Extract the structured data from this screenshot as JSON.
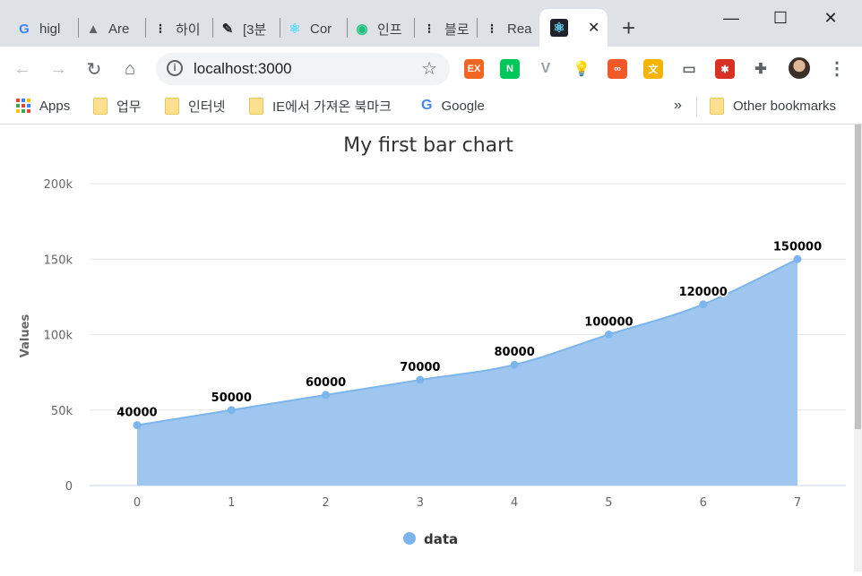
{
  "browser": {
    "tabs": [
      {
        "title": "higl",
        "icon": "google-icon",
        "fav": "G",
        "color": "#4285f4"
      },
      {
        "title": "Are",
        "icon": "arrow-logo-icon",
        "fav": "▲",
        "color": "#5f6368"
      },
      {
        "title": "하이",
        "icon": "dots-logo-icon",
        "fav": "⁝",
        "color": "#202124"
      },
      {
        "title": "[3분",
        "icon": "pen-icon",
        "fav": "✎",
        "color": "#202124"
      },
      {
        "title": "Cor",
        "icon": "react-icon",
        "fav": "⚛",
        "color": "#61dafb"
      },
      {
        "title": "인프",
        "icon": "inflearn-icon",
        "fav": "◉",
        "color": "#1dc078"
      },
      {
        "title": "블로",
        "icon": "dots-logo-icon",
        "fav": "⁝",
        "color": "#202124"
      },
      {
        "title": "Rea",
        "icon": "dots-logo-icon",
        "fav": "⁝",
        "color": "#202124"
      }
    ],
    "active_tab": {
      "icon": "react-icon",
      "fav": "⚛",
      "close": "✕"
    },
    "new_tab": "+",
    "window_controls": {
      "minimize": "—",
      "maximize": "☐",
      "close": "✕"
    },
    "nav": {
      "back": "←",
      "forward": "→",
      "reload": "↻",
      "home": "⌂"
    },
    "address": {
      "url": "localhost:3000",
      "info": "i",
      "star": "☆"
    },
    "extensions": [
      {
        "name": "ex-extension-icon",
        "label": "EX",
        "color": "#f26522"
      },
      {
        "name": "naver-extension-icon",
        "label": "N",
        "color": "#03c75a"
      },
      {
        "name": "vue-devtools-icon",
        "label": "V",
        "color": "#9aa0a6"
      },
      {
        "name": "lightbulb-extension-icon",
        "label": "💡",
        "color": "#3c4043"
      },
      {
        "name": "infinity-extension-icon",
        "label": "∞",
        "color": "#f1592a"
      },
      {
        "name": "translate-extension-icon",
        "label": "文",
        "color": "#f5b400"
      },
      {
        "name": "cast-extension-icon",
        "label": "▭",
        "color": "#5f6368"
      },
      {
        "name": "paw-extension-icon",
        "label": "✱",
        "color": "#d93025"
      },
      {
        "name": "puzzle-extensions-icon",
        "label": "✚",
        "color": "#5f6368"
      }
    ],
    "menu": "⋮",
    "bookmarks": [
      {
        "label": "Apps",
        "icon": "apps-grid-icon"
      },
      {
        "label": "업무",
        "icon": "folder-icon"
      },
      {
        "label": "인터넷",
        "icon": "folder-icon"
      },
      {
        "label": "IE에서 가져온 북마크",
        "icon": "folder-icon"
      },
      {
        "label": "Google",
        "icon": "google-icon"
      }
    ],
    "bookmarks_more": "»",
    "other_bookmarks": "Other bookmarks"
  },
  "chart_data": {
    "type": "area",
    "title": "My first bar chart",
    "ylabel": "Values",
    "xlabel": "",
    "x": [
      "0",
      "1",
      "2",
      "3",
      "4",
      "5",
      "6",
      "7"
    ],
    "series": [
      {
        "name": "data",
        "values": [
          40000,
          50000,
          60000,
          70000,
          80000,
          100000,
          120000,
          150000
        ]
      }
    ],
    "ylim": [
      0,
      200000
    ],
    "y_ticks": [
      0,
      50000,
      100000,
      150000,
      200000
    ],
    "y_tick_labels": [
      "0",
      "50k",
      "100k",
      "150k",
      "200k"
    ],
    "data_labels": true,
    "grid": true,
    "legend_position": "bottom",
    "series_color": "#7cb5ec",
    "fill_color": "#9ec6ef"
  }
}
